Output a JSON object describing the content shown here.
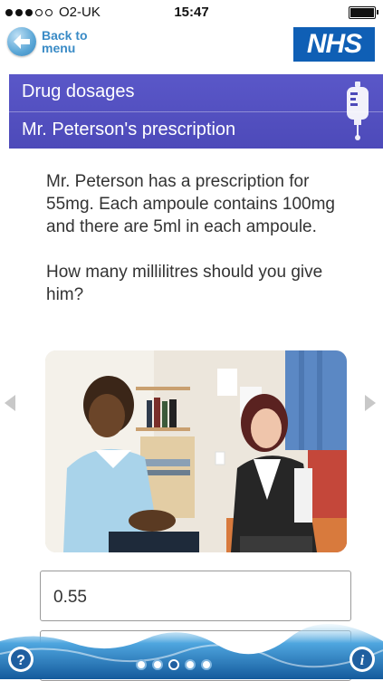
{
  "status_bar": {
    "carrier": "O2-UK",
    "time": "15:47",
    "signal_bars_filled": 3,
    "signal_bars_total": 5
  },
  "header": {
    "back_label": "Back to menu",
    "logo_text": "NHS"
  },
  "title_band": {
    "title": "Drug dosages",
    "subtitle": "Mr. Peterson's prescription",
    "icon": "iv-drip-bag-icon"
  },
  "question": {
    "scenario": "Mr. Peterson has a prescription for 55mg. Each ampoule contains 100mg and there are 5ml in each ampoule.",
    "prompt": "How many millilitres should you give him?"
  },
  "answers": [
    {
      "label": "0.55"
    }
  ],
  "footer": {
    "pages_total": 5,
    "current_page": 3
  },
  "colors": {
    "title_band": "#4f4cbc",
    "nhs_blue": "#0f5fb5",
    "link_blue": "#3a8bc6"
  }
}
